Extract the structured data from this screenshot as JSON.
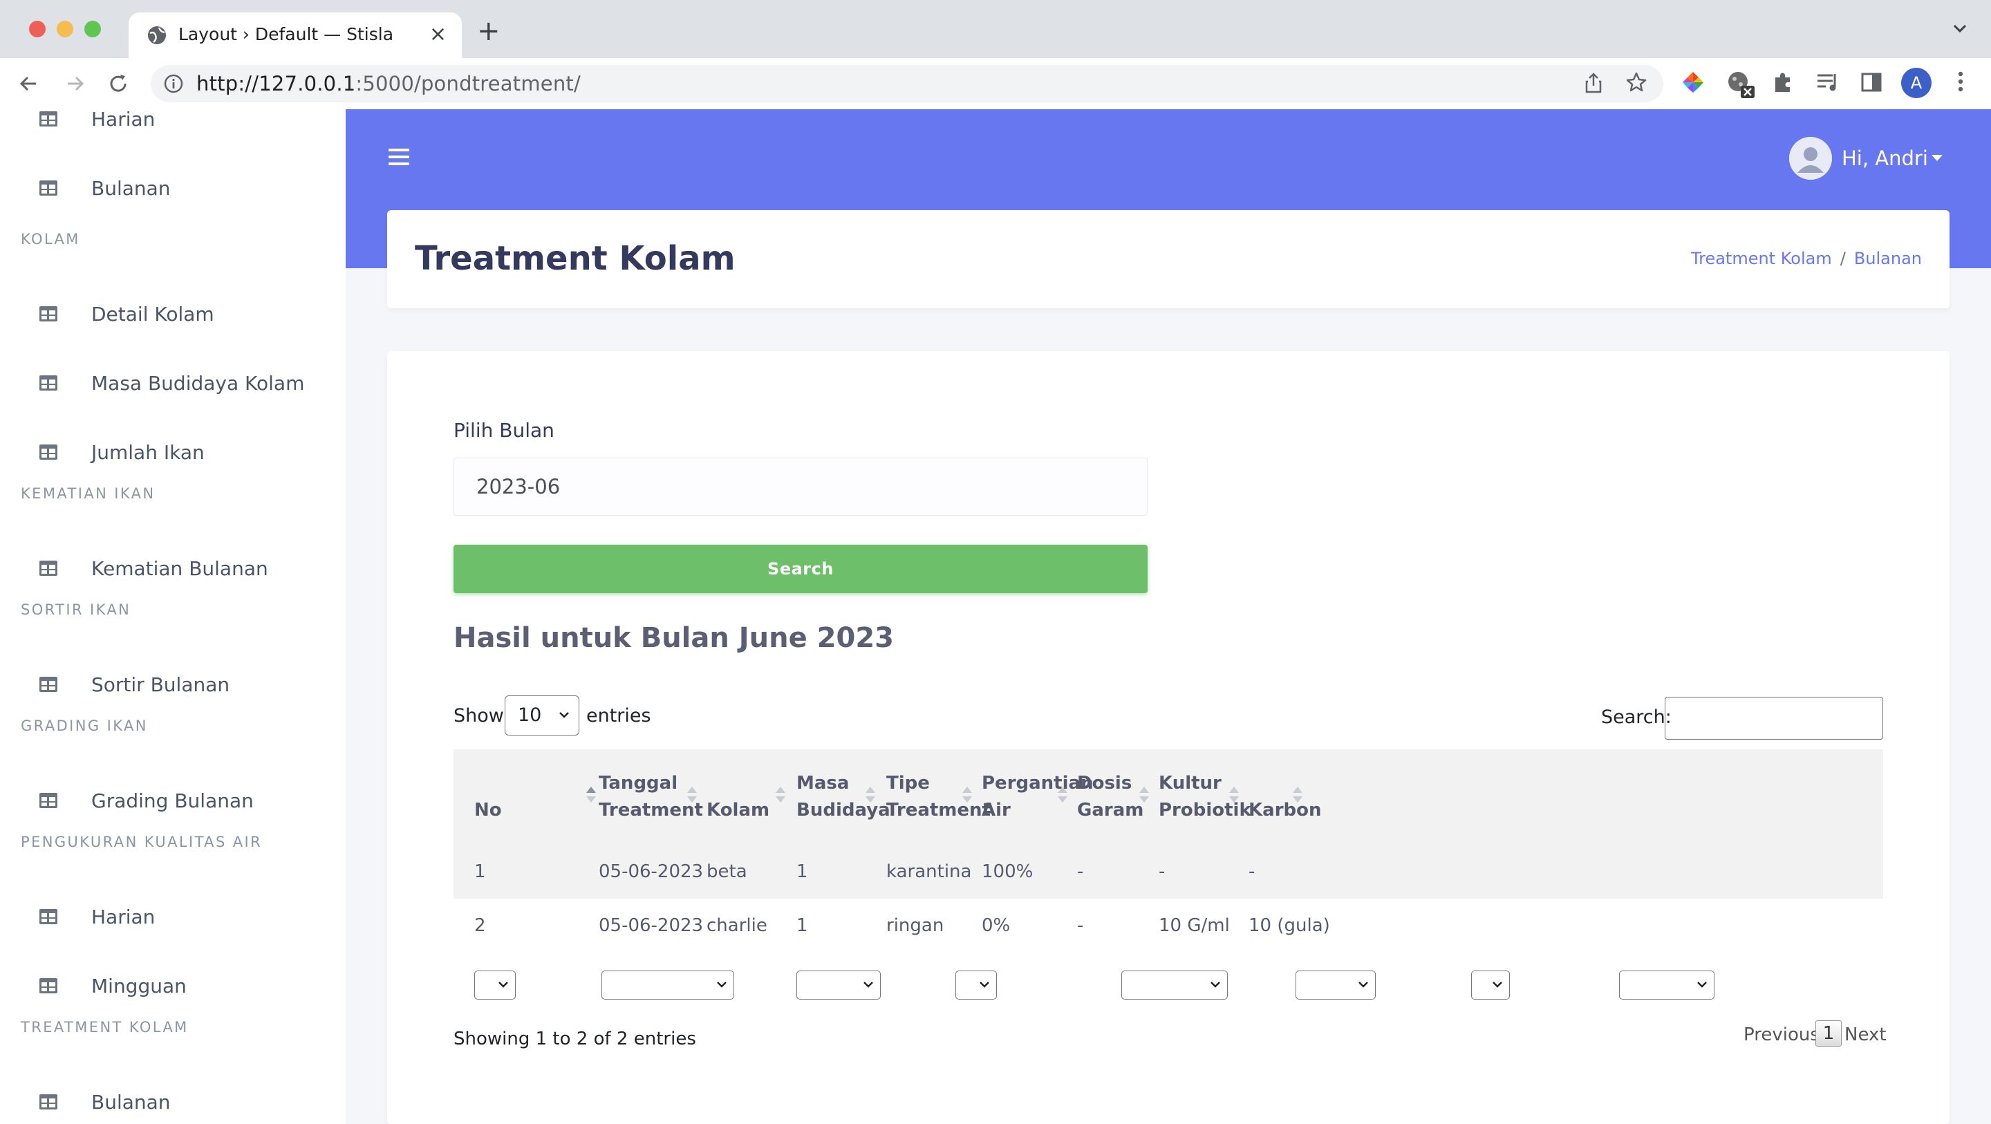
{
  "browser": {
    "tab_title": "Layout › Default — Stisla",
    "url_host": "http://127.0.0.1",
    "url_rest": ":5000/pondtreatment/",
    "profile_initial": "A"
  },
  "sidebar": {
    "sections": [
      {
        "type": "item",
        "label": "Harian"
      },
      {
        "type": "item",
        "label": "Bulanan"
      },
      {
        "type": "header",
        "label": "KOLAM"
      },
      {
        "type": "item",
        "label": "Detail Kolam"
      },
      {
        "type": "item",
        "label": "Masa Budidaya Kolam"
      },
      {
        "type": "item",
        "label": "Jumlah Ikan"
      },
      {
        "type": "header",
        "label": "KEMATIAN IKAN"
      },
      {
        "type": "item",
        "label": "Kematian Bulanan"
      },
      {
        "type": "header",
        "label": "SORTIR IKAN"
      },
      {
        "type": "item",
        "label": "Sortir Bulanan"
      },
      {
        "type": "header",
        "label": "GRADING IKAN"
      },
      {
        "type": "item",
        "label": "Grading Bulanan"
      },
      {
        "type": "header",
        "label": "PENGUKURAN KUALITAS AIR"
      },
      {
        "type": "item",
        "label": "Harian"
      },
      {
        "type": "item",
        "label": "Mingguan"
      },
      {
        "type": "header",
        "label": "TREATMENT KOLAM"
      },
      {
        "type": "item",
        "label": "Bulanan"
      }
    ]
  },
  "topbar": {
    "greeting": "Hi, Andri"
  },
  "page": {
    "title": "Treatment Kolam",
    "breadcrumb": [
      "Treatment Kolam",
      "Bulanan"
    ]
  },
  "form": {
    "month_label": "Pilih Bulan",
    "month_value": "2023-06",
    "search_button": "Search"
  },
  "results": {
    "title": "Hasil untuk Bulan June 2023",
    "show_label": "Show",
    "page_length": "10",
    "entries_label": "entries",
    "search_label": "Search:",
    "columns": [
      [
        "No"
      ],
      [
        "Tanggal",
        "Treatment"
      ],
      [
        "Kolam"
      ],
      [
        "Masa",
        "Budidaya"
      ],
      [
        "Tipe",
        "Treatment"
      ],
      [
        "Pergantian",
        "Air"
      ],
      [
        "Dosis",
        "Garam"
      ],
      [
        "Kultur",
        "Probiotik"
      ],
      [
        "Karbon"
      ]
    ],
    "rows": [
      [
        "1",
        "05-06-2023",
        "beta",
        "1",
        "karantina",
        "100%",
        "-",
        "-",
        "-"
      ],
      [
        "2",
        "05-06-2023",
        "charlie",
        "1",
        "ringan",
        "0%",
        "-",
        "10 G/ml",
        "10 (gula)"
      ]
    ],
    "info": "Showing 1 to 2 of 2 entries",
    "pagination": {
      "previous": "Previous",
      "current": "1",
      "next": "Next"
    }
  },
  "colors": {
    "primary": "#6777ef",
    "success": "#6dbf6a",
    "sidebar_bg": "#ffffff",
    "page_bg": "#f4f6f9"
  }
}
